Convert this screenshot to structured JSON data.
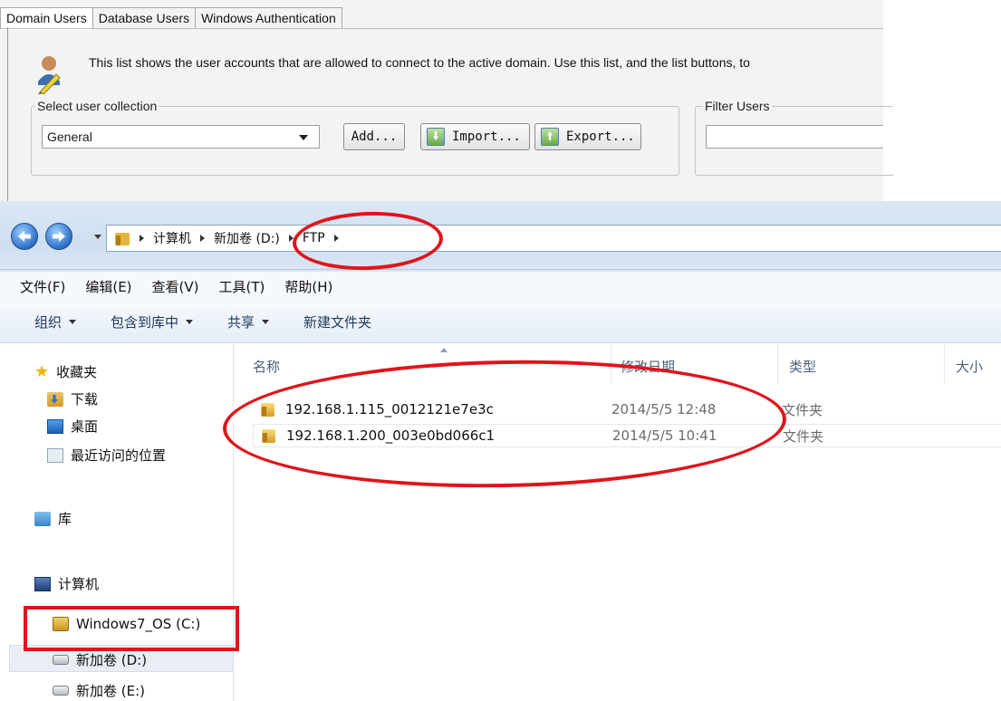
{
  "app_panel": {
    "tabs": [
      {
        "label": "Domain Users",
        "active": true
      },
      {
        "label": "Database Users",
        "active": false
      },
      {
        "label": "Windows Authentication",
        "active": false
      }
    ],
    "info_text": "This list shows the user accounts that are allowed to connect to the active domain. Use this list, and the list buttons, to",
    "select_collection": {
      "legend": "Select user collection",
      "value": "General"
    },
    "buttons": {
      "add": "Add...",
      "import": "Import...",
      "export": "Export..."
    },
    "filter": {
      "legend": "Filter Users",
      "value": ""
    }
  },
  "explorer": {
    "breadcrumb": [
      "计算机",
      "新加卷 (D:)",
      "FTP"
    ],
    "menu": [
      "文件(F)",
      "编辑(E)",
      "查看(V)",
      "工具(T)",
      "帮助(H)"
    ],
    "commands": [
      {
        "label": "组织",
        "dropdown": true
      },
      {
        "label": "包含到库中",
        "dropdown": true
      },
      {
        "label": "共享",
        "dropdown": true
      },
      {
        "label": "新建文件夹",
        "dropdown": false
      }
    ],
    "nav_pane": {
      "favorites": "收藏夹",
      "downloads": "下载",
      "desktop": "桌面",
      "recent": "最近访问的位置",
      "libraries": "库",
      "computer": "计算机",
      "drive_c": "Windows7_OS (C:)",
      "drive_d": "新加卷 (D:)",
      "drive_e": "新加卷 (E:)"
    },
    "columns": {
      "name": "名称",
      "date": "修改日期",
      "type": "类型",
      "size": "大小"
    },
    "files": [
      {
        "name": "192.168.1.115_0012121e7e3c",
        "date": "2014/5/5 12:48",
        "type": "文件夹"
      },
      {
        "name": "192.168.1.200_003e0bd066c1",
        "date": "2014/5/5 10:41",
        "type": "文件夹"
      }
    ]
  },
  "colors": {
    "annotation": "#e0141b",
    "explorer_chrome": "#dbe8f6"
  }
}
